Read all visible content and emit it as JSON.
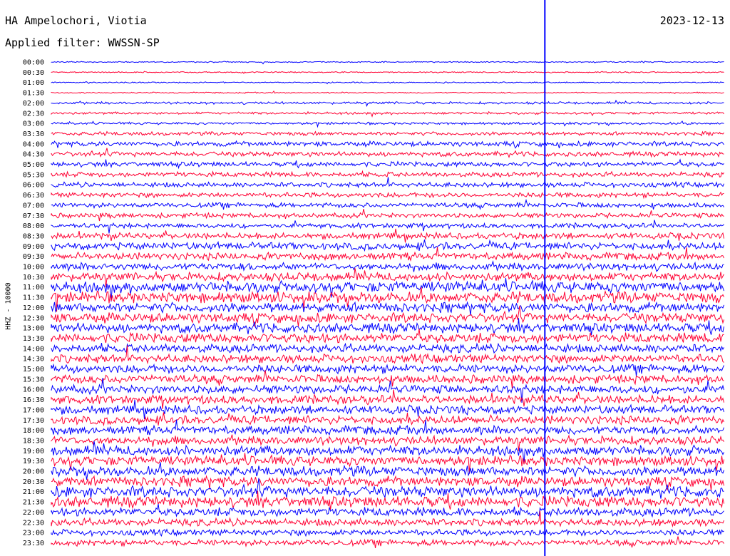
{
  "header": {
    "station": "HA Ampelochori, Viotia",
    "filter": "Applied filter: WWSSN-SP",
    "date": "2023-12-13",
    "channel": "HHZ - 10000"
  },
  "chart_data": {
    "type": "line",
    "title": "HA Ampelochori, Viotia",
    "subtitle": "Applied filter: WWSSN-SP",
    "ylabel": "HHZ - 10000",
    "y_tick_labels": [
      "00:00",
      "00:30",
      "01:00",
      "01:30",
      "02:00",
      "02:30",
      "03:00",
      "03:30",
      "04:00",
      "04:30",
      "05:00",
      "05:30",
      "06:00",
      "06:30",
      "07:00",
      "07:30",
      "08:00",
      "08:30",
      "09:00",
      "09:30",
      "10:00",
      "10:30",
      "11:00",
      "11:30",
      "12:00",
      "12:30",
      "13:00",
      "13:30",
      "14:00",
      "14:30",
      "15:00",
      "15:30",
      "16:00",
      "16:30",
      "17:00",
      "17:30",
      "18:00",
      "18:30",
      "19:00",
      "19:30",
      "20:00",
      "20:30",
      "21:00",
      "21:30",
      "22:00",
      "22:30",
      "23:00",
      "23:30"
    ],
    "series_colors": [
      "#0000ff",
      "#ff0033"
    ],
    "noise_level": [
      1,
      1,
      1,
      1,
      2,
      2,
      2,
      3,
      4,
      4,
      4,
      4,
      4,
      4,
      4,
      4,
      4,
      5,
      6,
      6,
      6,
      7,
      9,
      9,
      8,
      8,
      8,
      8,
      7,
      7,
      7,
      7,
      7,
      7,
      7,
      7,
      7,
      7,
      8,
      8,
      8,
      8,
      9,
      9,
      7,
      6,
      5,
      5
    ],
    "current_time_marker": "22:22",
    "grid": false
  }
}
